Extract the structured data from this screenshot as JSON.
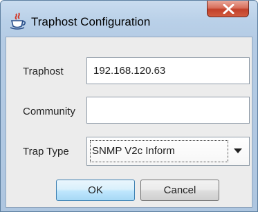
{
  "window": {
    "title": "Traphost Configuration",
    "close_glyph": "X"
  },
  "form": {
    "traphost": {
      "label": "Traphost",
      "value": "192.168.120.63"
    },
    "community": {
      "label": "Community",
      "value": ""
    },
    "trap_type": {
      "label": "Trap Type",
      "selected": "SNMP V2c Inform"
    }
  },
  "buttons": {
    "ok_label": "OK",
    "cancel_label": "Cancel"
  },
  "icons": {
    "app": "java-coffee-cup-icon",
    "close": "close-icon",
    "dropdown": "chevron-down-icon"
  },
  "colors": {
    "close_button": "#c2412a",
    "ok_button_border": "#3c7fb1",
    "title_bar": "#b9d0e8"
  }
}
